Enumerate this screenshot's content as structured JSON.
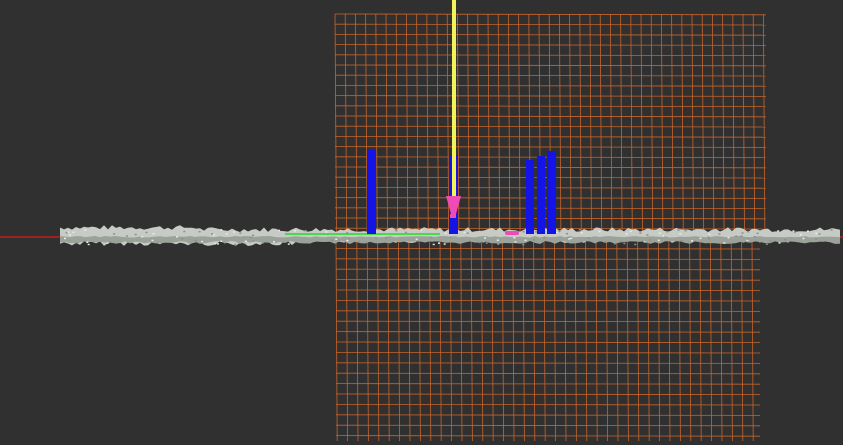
{
  "viewport": {
    "background": "#303030"
  },
  "colors": {
    "grid": "#c8642a",
    "x_axis": "#e01818",
    "y_axis": "#f2f25a",
    "pointcloud_light": "#c7cbc5",
    "pointcloud_dark": "#9aa29a",
    "obstacle": "#1414e6",
    "goal_marker": "#f04ab4",
    "path": "#22dd22"
  },
  "layers": {
    "grid": "map-grid",
    "pointcloud": "laser-point-cloud",
    "markers": "obstacle-markers",
    "pose": "goal-pose-arrow"
  }
}
